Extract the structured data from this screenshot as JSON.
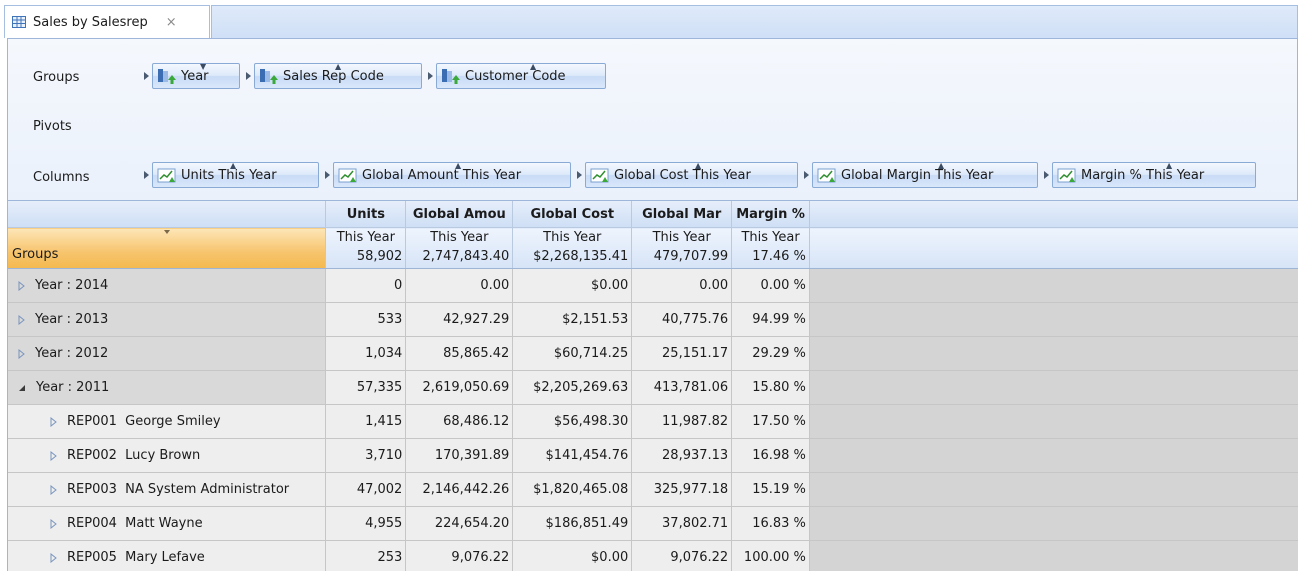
{
  "tab": {
    "title": "Sales by Salesrep",
    "close": "×"
  },
  "config": {
    "groups_label": "Groups",
    "pivots_label": "Pivots",
    "columns_label": "Columns",
    "groups": [
      "Year",
      "Sales Rep Code",
      "Customer Code"
    ],
    "columns": [
      "Units This Year",
      "Global Amount This Year",
      "Global Cost This Year",
      "Global Margin This Year",
      "Margin % This Year"
    ]
  },
  "grid": {
    "groups_header": "Groups",
    "headers": [
      "Units",
      "Global Amou",
      "Global Cost",
      "Global Mar",
      "Margin %"
    ],
    "subheaders": [
      "This Year",
      "This Year",
      "This Year",
      "This Year",
      "This Year"
    ],
    "totals": [
      "58,902",
      "2,747,843.40",
      "$2,268,135.41",
      "479,707.99",
      "17.46 %"
    ],
    "rows": [
      {
        "label": "Year : 2014",
        "values": [
          "0",
          "0.00",
          "$0.00",
          "0.00",
          "0.00 %"
        ]
      },
      {
        "label": "Year : 2013",
        "values": [
          "533",
          "42,927.29",
          "$2,151.53",
          "40,775.76",
          "94.99 %"
        ]
      },
      {
        "label": "Year : 2012",
        "values": [
          "1,034",
          "85,865.42",
          "$60,714.25",
          "25,151.17",
          "29.29 %"
        ]
      },
      {
        "label": "Year : 2011",
        "values": [
          "57,335",
          "2,619,050.69",
          "$2,205,269.63",
          "413,781.06",
          "15.80 %"
        ]
      },
      {
        "label": "REP001  George Smiley",
        "values": [
          "1,415",
          "68,486.12",
          "$56,498.30",
          "11,987.82",
          "17.50 %"
        ]
      },
      {
        "label": "REP002  Lucy Brown",
        "values": [
          "3,710",
          "170,391.89",
          "$141,454.76",
          "28,937.13",
          "16.98 %"
        ]
      },
      {
        "label": "REP003  NA System Administrator",
        "values": [
          "47,002",
          "2,146,442.26",
          "$1,820,465.08",
          "325,977.18",
          "15.19 %"
        ]
      },
      {
        "label": "REP004  Matt Wayne",
        "values": [
          "4,955",
          "224,654.20",
          "$186,851.49",
          "37,802.71",
          "16.83 %"
        ]
      },
      {
        "label": "REP005  Mary Lefave",
        "values": [
          "253",
          "9,076.22",
          "$0.00",
          "9,076.22",
          "100.00 %"
        ]
      }
    ]
  }
}
